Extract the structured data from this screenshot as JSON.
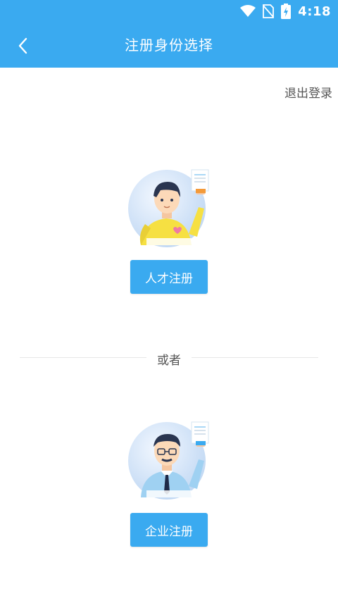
{
  "status_bar": {
    "time": "4:18",
    "icons": [
      "wifi-icon",
      "no-sim-icon",
      "battery-charging-icon"
    ]
  },
  "header": {
    "title": "注册身份选择",
    "back_icon": "chevron-left-icon"
  },
  "logout_label": "退出登录",
  "roles": [
    {
      "avatar": "talent-avatar-illustration",
      "button_label": "人才注册"
    },
    {
      "avatar": "enterprise-avatar-illustration",
      "button_label": "企业注册"
    }
  ],
  "divider_label": "或者",
  "colors": {
    "primary": "#3aaaf0",
    "background": "#ffffff",
    "text_secondary": "#555555"
  }
}
